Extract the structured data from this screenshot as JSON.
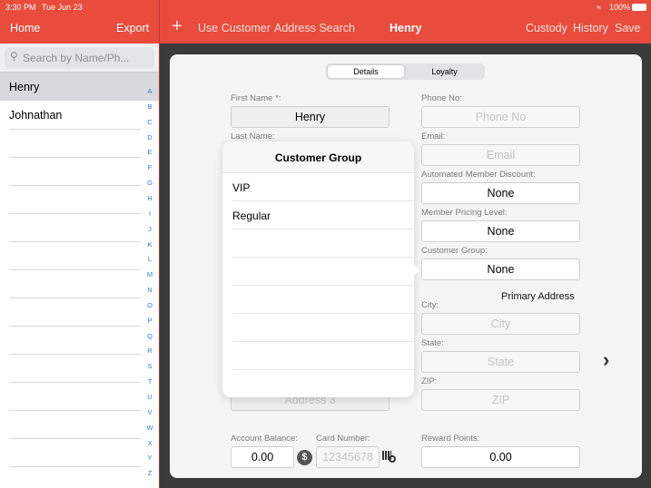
{
  "status": {
    "time": "3:30 PM",
    "date": "Tue Jun 23",
    "battery": "100%"
  },
  "left_nav": {
    "home": "Home",
    "export": "Export"
  },
  "search": {
    "placeholder": "Search by Name/Ph..."
  },
  "customers": [
    "Henry",
    "Johnathan"
  ],
  "index": [
    "A",
    "B",
    "C",
    "D",
    "E",
    "F",
    "G",
    "H",
    "I",
    "J",
    "K",
    "L",
    "M",
    "N",
    "O",
    "P",
    "Q",
    "R",
    "S",
    "T",
    "U",
    "V",
    "W",
    "X",
    "Y",
    "Z"
  ],
  "right_nav": {
    "add": "+",
    "use_customer": "Use Customer",
    "address_search": "Address Search",
    "title": "Henry",
    "custody": "Custody",
    "history": "History",
    "save": "Save"
  },
  "tabs": {
    "details": "Details",
    "loyalty": "Loyalty"
  },
  "form": {
    "first_name_label": "First Name *:",
    "first_name": "Henry",
    "last_name_label": "Last Name:",
    "address3_placeholder": "Address 3",
    "phone_label": "Phone No:",
    "phone_placeholder": "Phone No",
    "email_label": "Email:",
    "email_placeholder": "Email",
    "amd_label": "Automated Member Discount:",
    "amd": "None",
    "mpl_label": "Member Pricing Level:",
    "mpl": "None",
    "cg_label": "Customer Group:",
    "cg": "None",
    "primary_address": "Primary Address",
    "city_label": "City:",
    "city_placeholder": "City",
    "state_label": "State:",
    "state_placeholder": "State",
    "zip_label": "ZIP:",
    "zip_placeholder": "ZIP",
    "balance_label": "Account Balance:",
    "balance": "0.00",
    "card_label": "Card Number:",
    "card_placeholder": "12345678",
    "reward_label": "Reward Points:",
    "reward": "0.00"
  },
  "popover": {
    "title": "Customer Group",
    "items": [
      "VIP",
      "Regular"
    ]
  },
  "colors": {
    "accent": "#e84c3d",
    "index": "#2a7ae2"
  }
}
